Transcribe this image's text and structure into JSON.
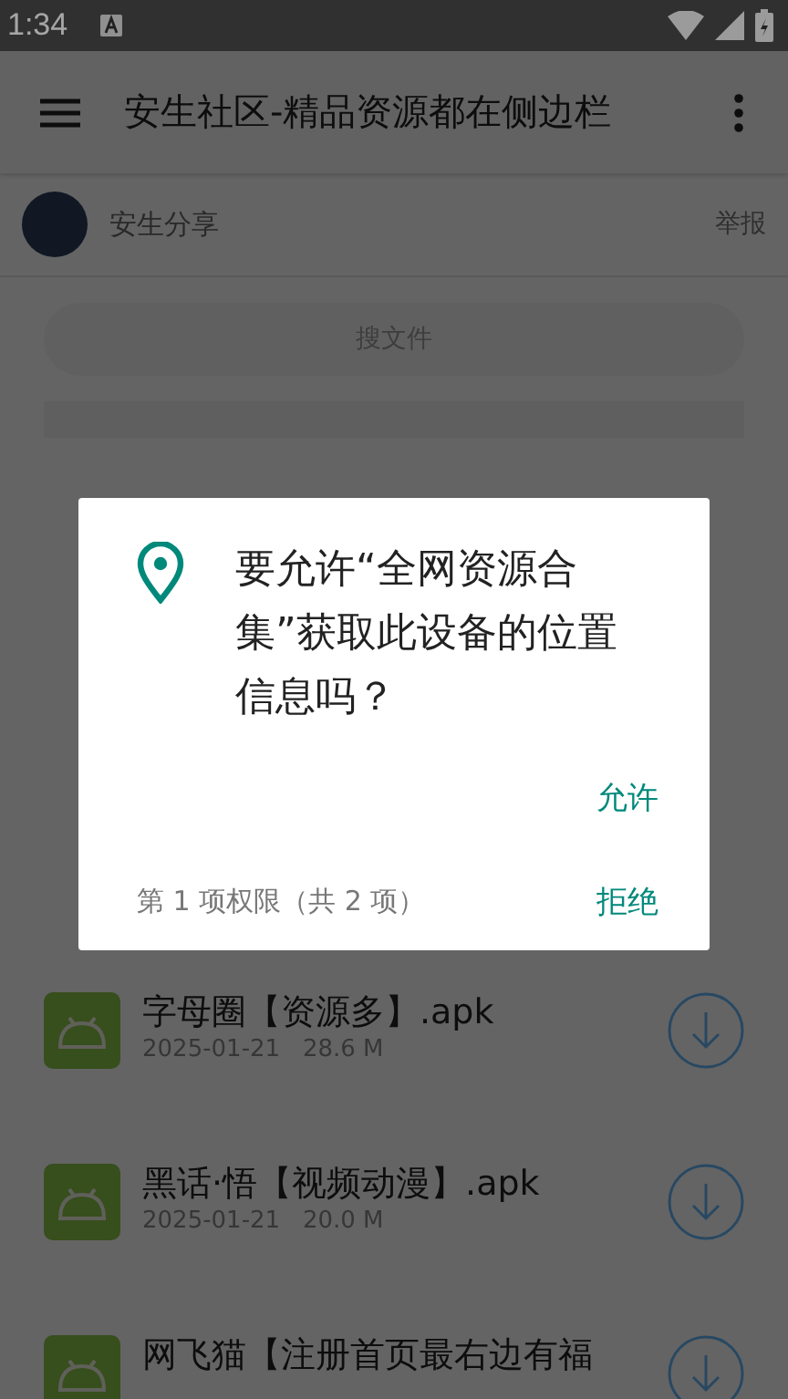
{
  "status_bar": {
    "time": "1:34"
  },
  "app_bar": {
    "title": "安生社区-精品资源都在侧边栏"
  },
  "author": {
    "name": "安生分享",
    "report": "举报"
  },
  "search": {
    "placeholder": "搜文件"
  },
  "files": [
    {
      "name": "字母圈【资源多】.apk",
      "date": "2025-01-21",
      "size": "28.6 M"
    },
    {
      "name": "黑话·悟【视频动漫】.apk",
      "date": "2025-01-21",
      "size": "20.0 M"
    },
    {
      "name": "网飞猫【注册首页最右边有福"
    }
  ],
  "dialog": {
    "message": "要允许“全网资源合集”获取此设备的位置信息吗？",
    "allow": "允许",
    "counter": "第 1 项权限（共 2 项）",
    "deny": "拒绝"
  }
}
